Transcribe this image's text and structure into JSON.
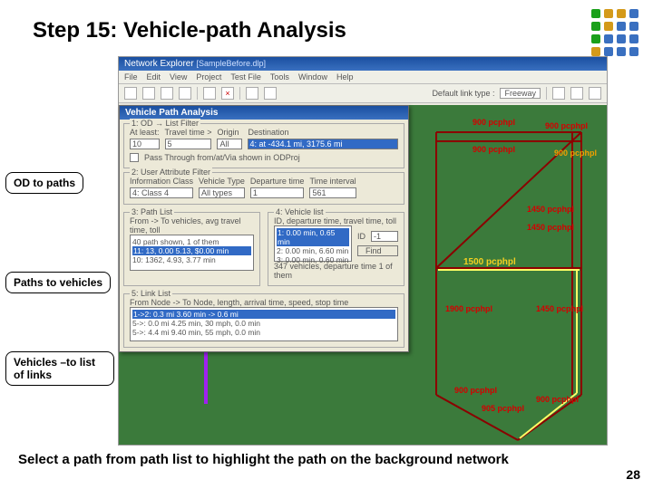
{
  "slide": {
    "title": "Step 15: Vehicle-path Analysis",
    "page_number": "28",
    "bottom_note": "Select a path from path list to highlight the path on the background network"
  },
  "dot_colors": [
    "#1aa01a",
    "#d49a1a",
    "#d49a1a",
    "#3a70c0",
    "#1aa01a",
    "#d49a1a",
    "#3a70c0",
    "#3a70c0",
    "#1aa01a",
    "#3a70c0",
    "#3a70c0",
    "#3a70c0",
    "#d49a1a",
    "#3a70c0",
    "#3a70c0",
    "#3a70c0"
  ],
  "callouts": {
    "od_paths": "OD to paths",
    "paths_vehicles": "Paths to vehicles",
    "vehicles_links": "Vehicles –to list of links"
  },
  "app": {
    "window_title": "Network Explorer",
    "window_subtitle": "[SampleBefore.dlp]",
    "menu": [
      "File",
      "Edit",
      "View",
      "Project",
      "Test File",
      "Tools",
      "Window",
      "Help"
    ],
    "toolbar_label": "Default link type :",
    "toolbar_dropdown": "Freeway"
  },
  "labels": {
    "n1": "900 pcphpl",
    "n2": "900 pcphpl",
    "n3": "900 pcphpl",
    "n4": "900 pcphpl",
    "n5": "1450 pcphpl",
    "n6": "1450 pcphpl",
    "n7": "1500 pcphpl",
    "n8": "1900 pcphpl",
    "n9": "1450 pcphpl",
    "n10": "900 pcphpl",
    "n11": "905 pcphpl",
    "n12": "900 pcphpl"
  },
  "dialog": {
    "title": "Vehicle Path Analysis",
    "g1": {
      "title": "1: OD → List Filter",
      "at_least": "At least:",
      "at_least_val": "10",
      "tt": "Travel time >",
      "tt_val": "5",
      "origin": "Origin",
      "dest": "Destination",
      "dest_val": "4: at -434.1 mi, 3175.6 mi",
      "all": "All",
      "chk": "Pass Through from/at/Via shown in ODProj"
    },
    "g2": {
      "title": "2: User Attribute Filter",
      "info": "Information Class",
      "veh": "Vehicle Type",
      "dep": "Departure time",
      "ti": "Time interval",
      "info_val": "4: Class 4",
      "veh_val": "All types",
      "dep_val": "1",
      "ti_val": "561"
    },
    "g3": {
      "title": "3: Path List",
      "sub": "From -> To vehicles, avg travel time, toll",
      "r1": "40 path shown, 1 of them",
      "r2": "11: 13, 0.00 5.13, $0.00 min",
      "r3": "10: 1362, 4.93, 3.77 min"
    },
    "g4": {
      "title": "4: Vehicle list",
      "sub": "ID, departure time, travel time, toll",
      "col_id": "ID",
      "col_vehid": "-1",
      "r1": "1: 0.00 min, 0.65 min",
      "r2": "2: 0.00 min, 6.60 min",
      "r3": "3: 0.00 min, 0.60 min",
      "find": "Find",
      "note": "347 vehicles, departure time 1 of them"
    },
    "g5": {
      "title": "5: Link List",
      "sub": "From Node -> To Node, length, arrival time, speed, stop time",
      "r1": "1->2: 0.3 mi 3.60 min -> 0.6 mi",
      "r2": "5->: 0.0 mi 4.25 min, 30 mph, 0.0 min",
      "r3": "5->: 4.4 mi 9.40 min, 55 mph, 0.0 min"
    }
  }
}
